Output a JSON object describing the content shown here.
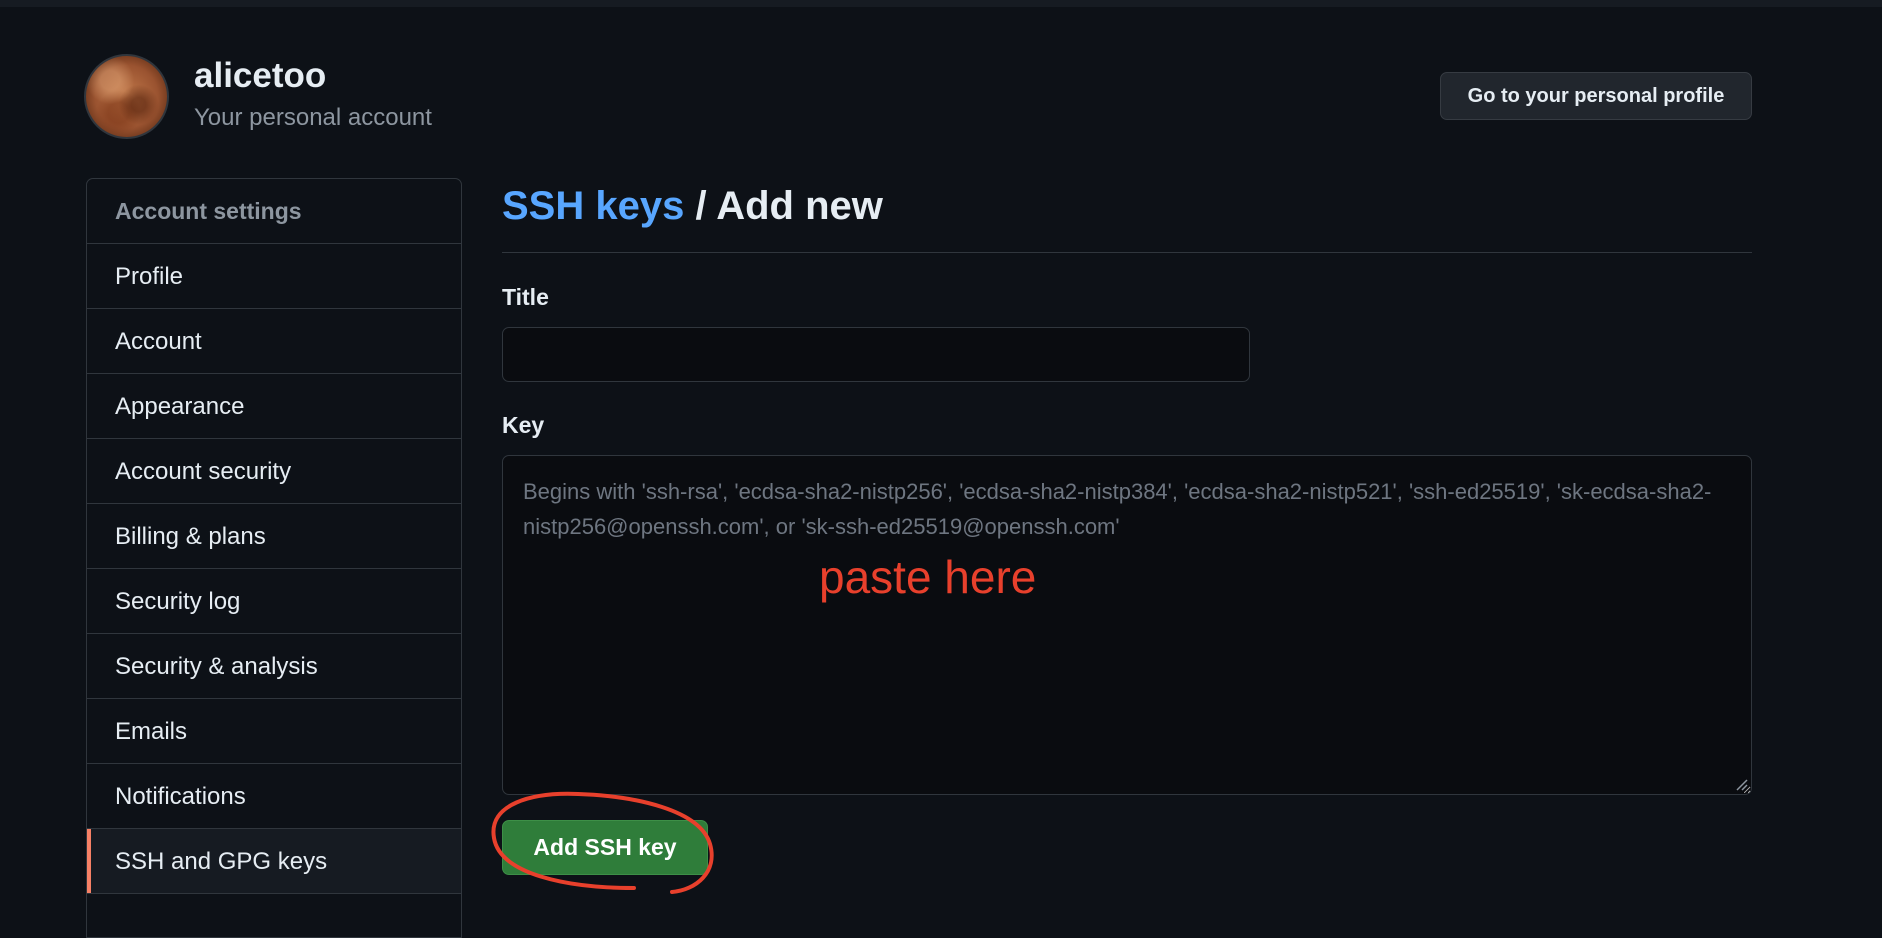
{
  "header": {
    "username": "alicetoo",
    "subtitle": "Your personal account",
    "profile_button": "Go to your personal profile"
  },
  "sidebar": {
    "heading": "Account settings",
    "items": [
      {
        "label": "Profile"
      },
      {
        "label": "Account"
      },
      {
        "label": "Appearance"
      },
      {
        "label": "Account security"
      },
      {
        "label": "Billing & plans"
      },
      {
        "label": "Security log"
      },
      {
        "label": "Security & analysis"
      },
      {
        "label": "Emails"
      },
      {
        "label": "Notifications"
      },
      {
        "label": "SSH and GPG keys",
        "active": true
      }
    ]
  },
  "main": {
    "breadcrumb_link": "SSH keys",
    "breadcrumb_separator": " / ",
    "breadcrumb_current": "Add new",
    "title_label": "Title",
    "title_value": "",
    "key_label": "Key",
    "key_placeholder": "Begins with 'ssh-rsa', 'ecdsa-sha2-nistp256', 'ecdsa-sha2-nistp384', 'ecdsa-sha2-nistp521', 'ssh-ed25519', 'sk-ecdsa-sha2-nistp256@openssh.com', or 'sk-ssh-ed25519@openssh.com'",
    "submit_label": "Add SSH key"
  },
  "annotation": {
    "text": "paste here",
    "color": "#e8402c"
  },
  "colors": {
    "background": "#0d1117",
    "link": "#58a6ff",
    "active_indicator": "#f78166",
    "primary_button": "#2f7d3a"
  }
}
